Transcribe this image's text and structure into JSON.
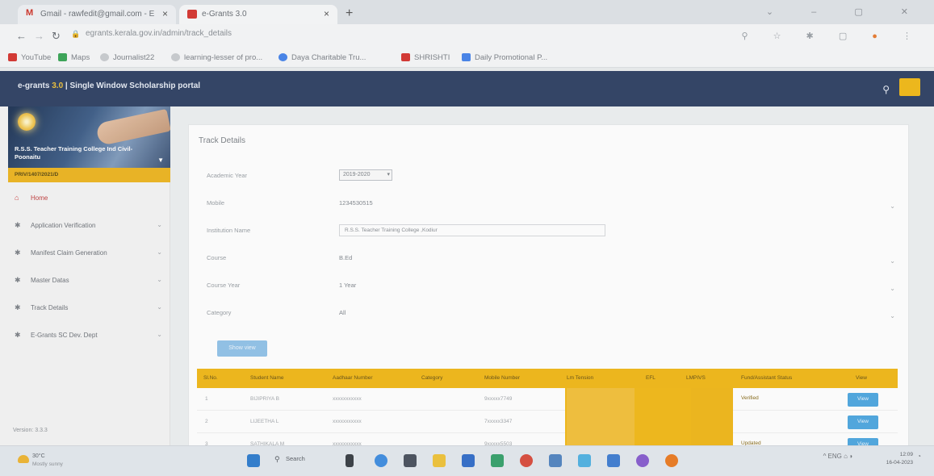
{
  "browser": {
    "tabs": [
      {
        "label": "Gmail - rawfedit@gmail.com - E"
      },
      {
        "label": "e-Grants 3.0"
      }
    ],
    "url": "egrants.kerala.gov.in/admin/track_details",
    "bookmarks": [
      {
        "label": "YouTube",
        "color": "#e0342f"
      },
      {
        "label": "Maps",
        "color": "#34a853"
      },
      {
        "label": "Journalist22",
        "color": "#5f6368"
      },
      {
        "label": "learning-lesser of pro...",
        "color": "#5f6368"
      },
      {
        "label": "Daya Charitable Tru...",
        "color": "#4285f4"
      },
      {
        "label": "SHRISHTI",
        "color": "#e0342f"
      },
      {
        "label": "Daily Promotional P...",
        "color": "#4285f4"
      }
    ]
  },
  "header": {
    "title_prefix": "e-grants",
    "title_version": "3.0",
    "title_suffix": "| Single Window Scholarship portal"
  },
  "sidebar": {
    "institution": "R.S.S. Teacher Training College Ind Civil-Poonaitu",
    "institution_code": "PRIV/1407/2021/D",
    "items": [
      {
        "label": "Home",
        "icon": "home-icon",
        "active": true
      },
      {
        "label": "Application Verification",
        "icon": "gear-icon"
      },
      {
        "label": "Manifest Claim Generation",
        "icon": "gear-icon"
      },
      {
        "label": "Master Datas",
        "icon": "gear-icon"
      },
      {
        "label": "Track Details",
        "icon": "gear-icon"
      },
      {
        "label": "E-Grants SC Dev. Dept",
        "icon": "gear-icon"
      }
    ],
    "version": "Version: 3.3.3"
  },
  "main": {
    "card_title": "Track Details",
    "fields": [
      {
        "label": "Academic Year",
        "value": "2019-2020",
        "kind": "select"
      },
      {
        "label": "Mobile",
        "value": "1234530515",
        "kind": "text"
      },
      {
        "label": "Institution Name",
        "value": "R.S.S. Teacher Training College ,Kodiur",
        "kind": "input"
      },
      {
        "label": "Course",
        "value": "B.Ed",
        "kind": "text"
      },
      {
        "label": "Course Year",
        "value": "1 Year",
        "kind": "text"
      },
      {
        "label": "Category",
        "value": "All",
        "kind": "text"
      }
    ],
    "show_button": "Show view",
    "table": {
      "headers": [
        "Sl.No.",
        "Student Name",
        "Aadhaar Number",
        "Category",
        "Mobile Number",
        "Lm Tension",
        "EFL",
        "LMPIVS",
        "Fund/Assistant Status",
        "View"
      ],
      "rows": [
        {
          "sl": "1",
          "name": "BIJIPRIYA B",
          "aadhaar": "xxxxxxxxxxx",
          "category": "",
          "mobile": "9xxxxx7749",
          "status": "Verified",
          "view": "View"
        },
        {
          "sl": "2",
          "name": "LIJEETHA L",
          "aadhaar": "xxxxxxxxxxx",
          "category": "",
          "mobile": "7xxxxx3347",
          "status": "",
          "view": "View"
        },
        {
          "sl": "3",
          "name": "SATHIKALA M",
          "aadhaar": "xxxxxxxxxxx",
          "category": "",
          "mobile": "9xxxxx5503",
          "status": "Updated",
          "view": "View"
        }
      ]
    }
  },
  "taskbar": {
    "weather_temp": "30°C",
    "weather_desc": "Mostly sunny",
    "search": "Search",
    "time": "12:09",
    "date": "16-04-2023",
    "lang": "ENG"
  }
}
